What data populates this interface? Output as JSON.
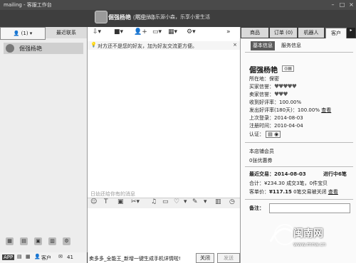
{
  "window": {
    "title": "mailing - 客服工作台"
  },
  "topbar": {
    "name": "倔强杨艳",
    "tag": "(陌生人)",
    "welcome": "欢迎光临乐源小森，乐享小爱生活"
  },
  "left_tabs": {
    "count_label": "(1)",
    "recent": "最近联系"
  },
  "contacts": [
    {
      "name": "倔强杨艳"
    }
  ],
  "left_bottom": {
    "customer": "客户",
    "count": "41"
  },
  "chat": {
    "notice": "对方还不是您的好友，加为好友交流更方便。",
    "notice_link": "加为好友",
    "history_hint": "日幼还给你有的消息",
    "ad_text": "卖多多_全能王_新增一键生成手机详情啦!",
    "close_button": "关闭",
    "send_button": "发送"
  },
  "right_tabs": {
    "products": "商品",
    "orders": "订单 (0)",
    "robot": "机器人",
    "customer": "客户"
  },
  "sub_tabs": {
    "basic": "基本信息",
    "service": "服务信息"
  },
  "profile": {
    "name": "倔强杨艳",
    "location_label": "所在地：",
    "location": "保密",
    "buyer_credit_label": "买家信誉：",
    "seller_credit_label": "卖家信誉：",
    "received_rate_label": "收到好评率：",
    "received_rate": "100.00%",
    "sent_rate_label": "发出好评率(180天)：",
    "sent_rate": "100.00%",
    "view": "查看",
    "last_login_label": "上次登录：",
    "last_login": "2014-08-03",
    "register_label": "注册时间：",
    "register": "2010-04-04",
    "auth_label": "认证："
  },
  "shop": {
    "member": "本店铺会员",
    "coupon": "0张优惠券"
  },
  "trade": {
    "recent_label": "最近交易：",
    "recent_date": "2014-08-03",
    "status": "进行中6笔",
    "total_label": "合计：",
    "total": "¥234.30",
    "success": "成交3笔，0件宝贝",
    "per_label": "客单价：",
    "per": "¥117.15",
    "closed": "0笔交易被关闭",
    "view": "查看"
  },
  "note": {
    "label": "备注："
  },
  "watermark": {
    "brand": "闽南网",
    "url": "www.mnw.cn"
  }
}
